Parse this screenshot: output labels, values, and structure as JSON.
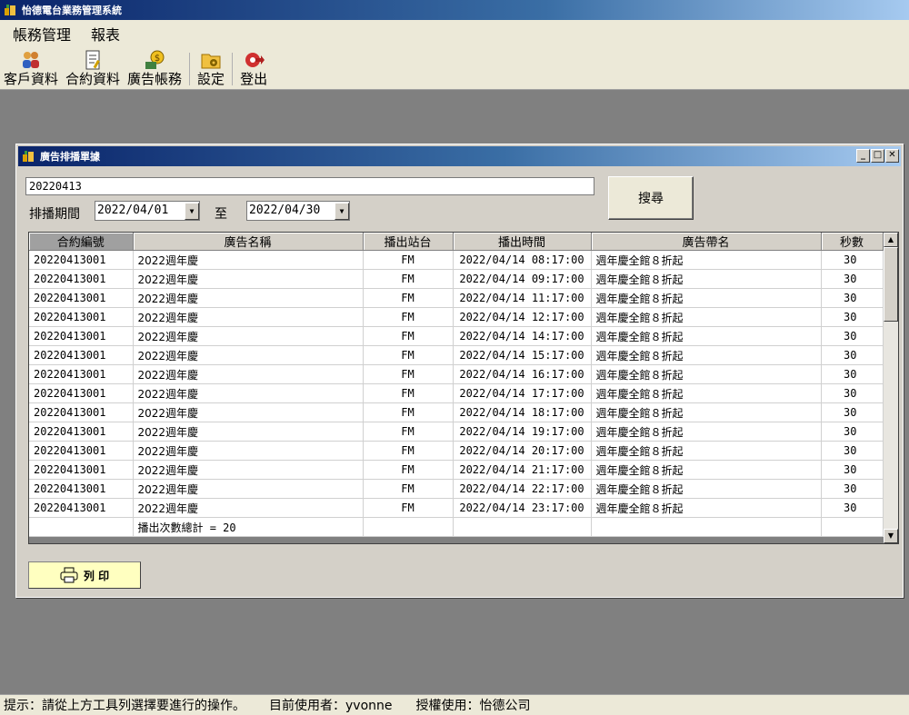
{
  "app": {
    "title": "怡德電台業務管理系統"
  },
  "menu": {
    "items": [
      "帳務管理",
      "報表"
    ]
  },
  "toolbar": {
    "customer": "客戶資料",
    "contract": "合約資料",
    "ad_billing": "廣告帳務",
    "settings": "設定",
    "logout": "登出"
  },
  "child_window": {
    "title": "廣告排播單據",
    "search_value": "20220413",
    "search_button": "搜尋",
    "period_label": "排播期間",
    "date_from": "2022/04/01",
    "to_label": "至",
    "date_to": "2022/04/30",
    "print_button": "列 印"
  },
  "table": {
    "columns": [
      "合約編號",
      "廣告名稱",
      "播出站台",
      "播出時間",
      "廣告帶名",
      "秒數"
    ],
    "rows": [
      [
        "20220413001",
        "2022週年慶",
        "FM",
        "2022/04/14 08:17:00",
        "週年慶全館８折起",
        "30"
      ],
      [
        "20220413001",
        "2022週年慶",
        "FM",
        "2022/04/14 09:17:00",
        "週年慶全館８折起",
        "30"
      ],
      [
        "20220413001",
        "2022週年慶",
        "FM",
        "2022/04/14 11:17:00",
        "週年慶全館８折起",
        "30"
      ],
      [
        "20220413001",
        "2022週年慶",
        "FM",
        "2022/04/14 12:17:00",
        "週年慶全館８折起",
        "30"
      ],
      [
        "20220413001",
        "2022週年慶",
        "FM",
        "2022/04/14 14:17:00",
        "週年慶全館８折起",
        "30"
      ],
      [
        "20220413001",
        "2022週年慶",
        "FM",
        "2022/04/14 15:17:00",
        "週年慶全館８折起",
        "30"
      ],
      [
        "20220413001",
        "2022週年慶",
        "FM",
        "2022/04/14 16:17:00",
        "週年慶全館８折起",
        "30"
      ],
      [
        "20220413001",
        "2022週年慶",
        "FM",
        "2022/04/14 17:17:00",
        "週年慶全館８折起",
        "30"
      ],
      [
        "20220413001",
        "2022週年慶",
        "FM",
        "2022/04/14 18:17:00",
        "週年慶全館８折起",
        "30"
      ],
      [
        "20220413001",
        "2022週年慶",
        "FM",
        "2022/04/14 19:17:00",
        "週年慶全館８折起",
        "30"
      ],
      [
        "20220413001",
        "2022週年慶",
        "FM",
        "2022/04/14 20:17:00",
        "週年慶全館８折起",
        "30"
      ],
      [
        "20220413001",
        "2022週年慶",
        "FM",
        "2022/04/14 21:17:00",
        "週年慶全館８折起",
        "30"
      ],
      [
        "20220413001",
        "2022週年慶",
        "FM",
        "2022/04/14 22:17:00",
        "週年慶全館８折起",
        "30"
      ],
      [
        "20220413001",
        "2022週年慶",
        "FM",
        "2022/04/14 23:17:00",
        "週年慶全館８折起",
        "30"
      ]
    ],
    "total_label": "播出次數總計 = 20"
  },
  "status": {
    "hint": "提示：請從上方工具列選擇要進行的操作。",
    "user": "目前使用者：yvonne",
    "license": "授權使用：怡德公司"
  }
}
